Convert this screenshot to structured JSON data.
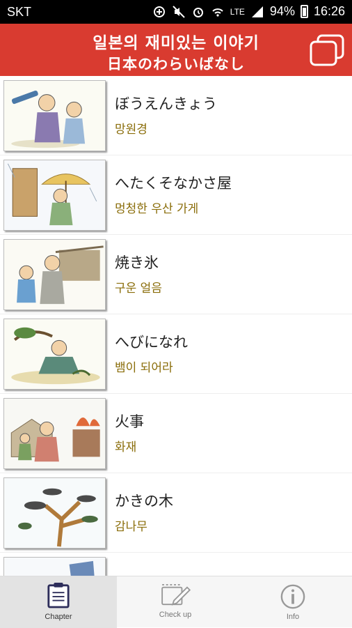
{
  "status_bar": {
    "carrier": "SKT",
    "network": "LTE",
    "battery": "94%",
    "time": "16:26"
  },
  "header": {
    "title_korean": "일본의 재미있는 이야기",
    "title_japanese": "日本のわらいばなし",
    "header_color": "#d93b30"
  },
  "stories": [
    {
      "title": "ぼうえんきょう",
      "translation": "망원경"
    },
    {
      "title": "へたくそなかさ屋",
      "translation": "멍청한 우산 가게"
    },
    {
      "title": "焼き氷",
      "translation": "구운 얼음"
    },
    {
      "title": "へびになれ",
      "translation": "뱀이 되어라"
    },
    {
      "title": "火事",
      "translation": "화재"
    },
    {
      "title": "かきの木",
      "translation": "감나무"
    },
    {
      "title": "",
      "translation": ""
    }
  ],
  "tabs": [
    {
      "label": "Chapter",
      "icon": "clipboard-icon",
      "active": true
    },
    {
      "label": "Check up",
      "icon": "checkup-pencil-icon",
      "active": false
    },
    {
      "label": "Info",
      "icon": "info-icon",
      "active": false
    }
  ]
}
